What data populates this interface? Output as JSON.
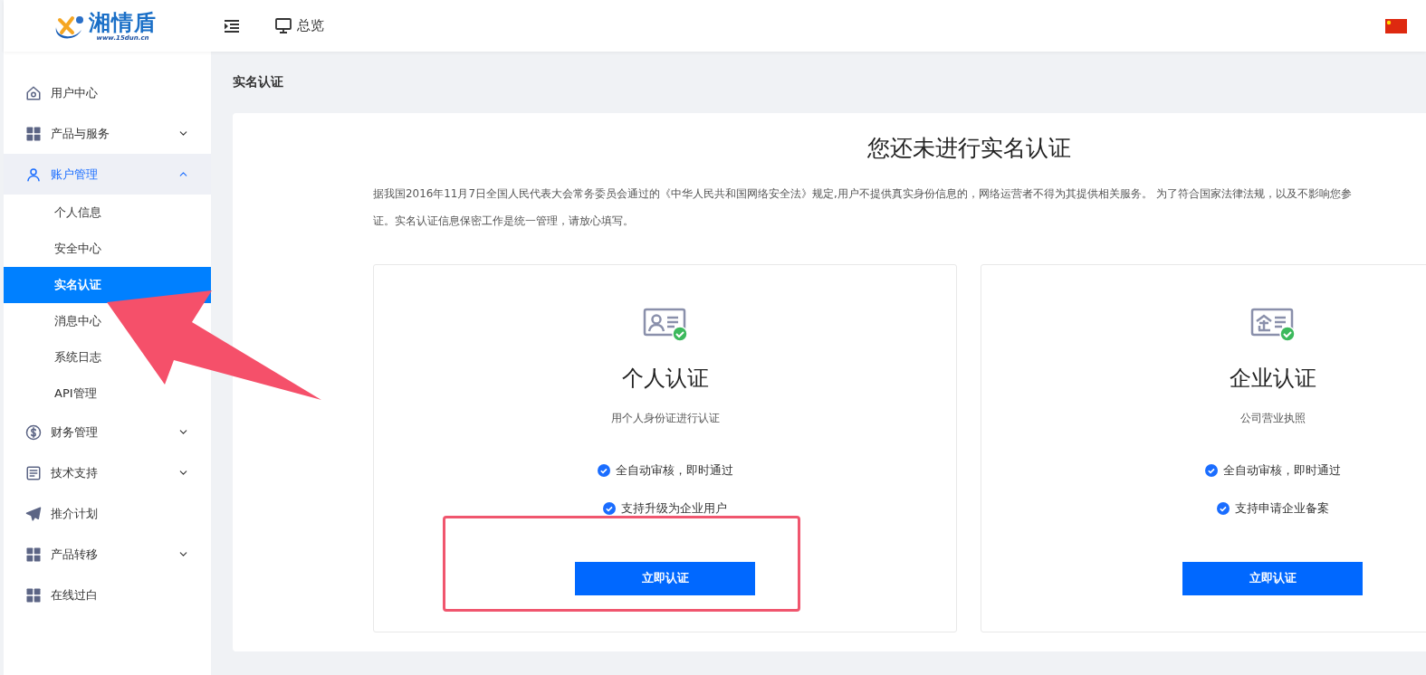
{
  "header": {
    "logo": {
      "name": "湘情盾",
      "url": "www.15dun.cn"
    },
    "nav": [
      {
        "label": "总览"
      }
    ]
  },
  "sidebar": {
    "items": [
      {
        "label": "用户中心"
      },
      {
        "label": "产品与服务",
        "expanded": false
      },
      {
        "label": "账户管理",
        "expanded": true,
        "children": [
          {
            "label": "个人信息",
            "selected": false
          },
          {
            "label": "安全中心",
            "selected": false
          },
          {
            "label": "实名认证",
            "selected": true
          },
          {
            "label": "消息中心",
            "selected": false
          },
          {
            "label": "系统日志",
            "selected": false
          },
          {
            "label": "API管理",
            "selected": false
          }
        ]
      },
      {
        "label": "财务管理",
        "expanded": false
      },
      {
        "label": "技术支持",
        "expanded": false
      },
      {
        "label": "推介计划"
      },
      {
        "label": "产品转移",
        "expanded": false
      },
      {
        "label": "在线过白"
      }
    ]
  },
  "breadcrumb": "实名认证",
  "main": {
    "title": "您还未进行实名认证",
    "paragraph_lines": [
      "据我国2016年11月7日全国人民代表大会常务委员会通过的《中华人民共和国网络安全法》规定,用户不提供真实身份信息的，网络运营者不得为其提供相关服务。 为了符合国家法律法规，以及不影响您参",
      "证。实名认证信息保密工作是统一管理，请放心填写。"
    ],
    "options": [
      {
        "kind": "personal",
        "title": "个人认证",
        "subtitle": "用个人身份证进行认证",
        "features": [
          "全自动审核，即时通过",
          "支持升级为企业用户"
        ],
        "button": "立即认证",
        "highlighted": true
      },
      {
        "kind": "business",
        "title": "企业认证",
        "subtitle": "公司营业执照",
        "features": [
          "全自动审核，即时通过",
          "支持申请企业备案"
        ],
        "button": "立即认证",
        "highlighted": false
      }
    ]
  },
  "annotation": {
    "arrow": true
  }
}
